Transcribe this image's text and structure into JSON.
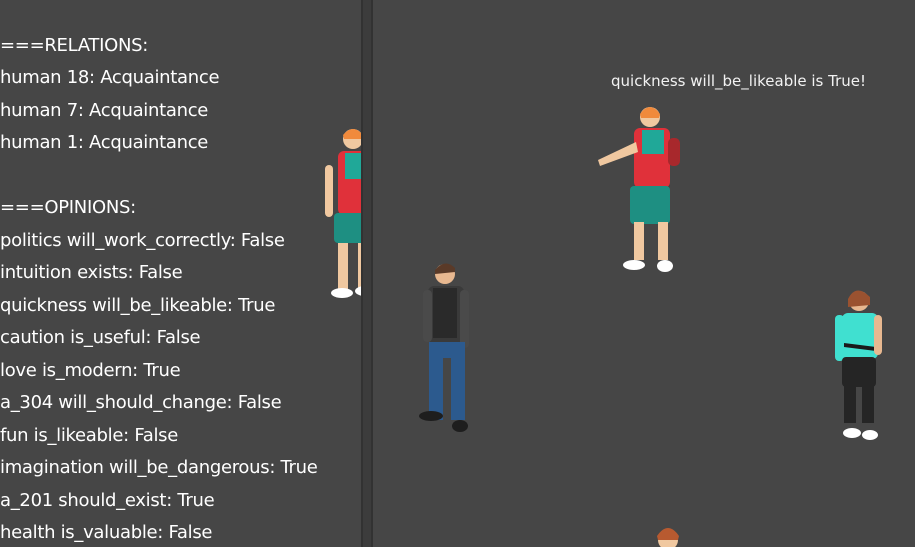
{
  "relations": {
    "header": "===RELATIONS:",
    "items": [
      "human 18: Acquaintance",
      "human 7: Acquaintance",
      "human 1: Acquaintance"
    ]
  },
  "opinions": {
    "header": "===OPINIONS:",
    "items": [
      "politics will_work_correctly: False",
      "intuition exists: False",
      "quickness will_be_likeable: True",
      "caution is_useful: False",
      "love is_modern: True",
      "a_304 will_should_change: False",
      "fun is_likeable: False",
      "imagination will_be_dangerous: True",
      "a_201 should_exist: True",
      "health is_valuable: False"
    ]
  },
  "speech_bubble": "quickness will_be_likeable is True!",
  "colors": {
    "background": "#464646",
    "divider": "#323232",
    "text": "#ffffff"
  }
}
